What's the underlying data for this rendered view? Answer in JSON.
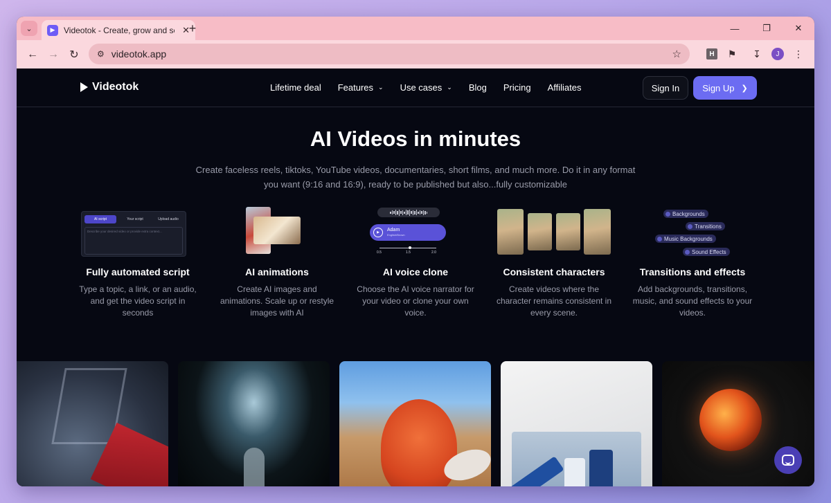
{
  "browser": {
    "tab_title": "Videotok - Create, grow and scale",
    "url": "videotok.app",
    "profile_initial": "J",
    "extension_label": "H"
  },
  "nav": {
    "logo_text": "Videotok",
    "items": [
      {
        "label": "Lifetime deal",
        "has_dropdown": false
      },
      {
        "label": "Features",
        "has_dropdown": true
      },
      {
        "label": "Use cases",
        "has_dropdown": true
      },
      {
        "label": "Blog",
        "has_dropdown": false
      },
      {
        "label": "Pricing",
        "has_dropdown": false
      },
      {
        "label": "Affiliates",
        "has_dropdown": false
      }
    ],
    "sign_in": "Sign In",
    "sign_up": "Sign Up"
  },
  "hero": {
    "title": "AI Videos in minutes",
    "subtitle": "Create faceless reels, tiktoks, YouTube videos, documentaries, short films, and much more. Do it in any format you want (9:16 and 16:9), ready to be published but also...fully customizable"
  },
  "features": [
    {
      "title": "Fully automated script",
      "desc": "Type a topic, a link, or an audio, and get the video script in seconds",
      "tabs": [
        "AI script",
        "Your script",
        "Upload audio"
      ],
      "input_placeholder": "Describe your desired video or provide extra context..."
    },
    {
      "title": "AI animations",
      "desc": "Create AI images and animations. Scale up or restyle images with AI"
    },
    {
      "title": "AI voice clone",
      "desc": "Choose the AI voice narrator for your video or clone your own voice.",
      "voice_name": "Adam",
      "voice_sub": "English/Brown",
      "speed_ticks": [
        "0.5",
        "1.5",
        "2.0"
      ]
    },
    {
      "title": "Consistent characters",
      "desc": "Create videos where the character remains consistent in every scene."
    },
    {
      "title": "Transitions and effects",
      "desc": "Add backgrounds, transitions, music, and sound effects to your videos.",
      "chips": [
        "Backgrounds",
        "Transitions",
        "Music Backgrounds",
        "Sound Effects"
      ]
    }
  ],
  "colors": {
    "page_bg": "#060812",
    "accent": "#6c6cf2",
    "tab_strip": "#f7bcc6",
    "chat_button": "#4a3fb5"
  }
}
